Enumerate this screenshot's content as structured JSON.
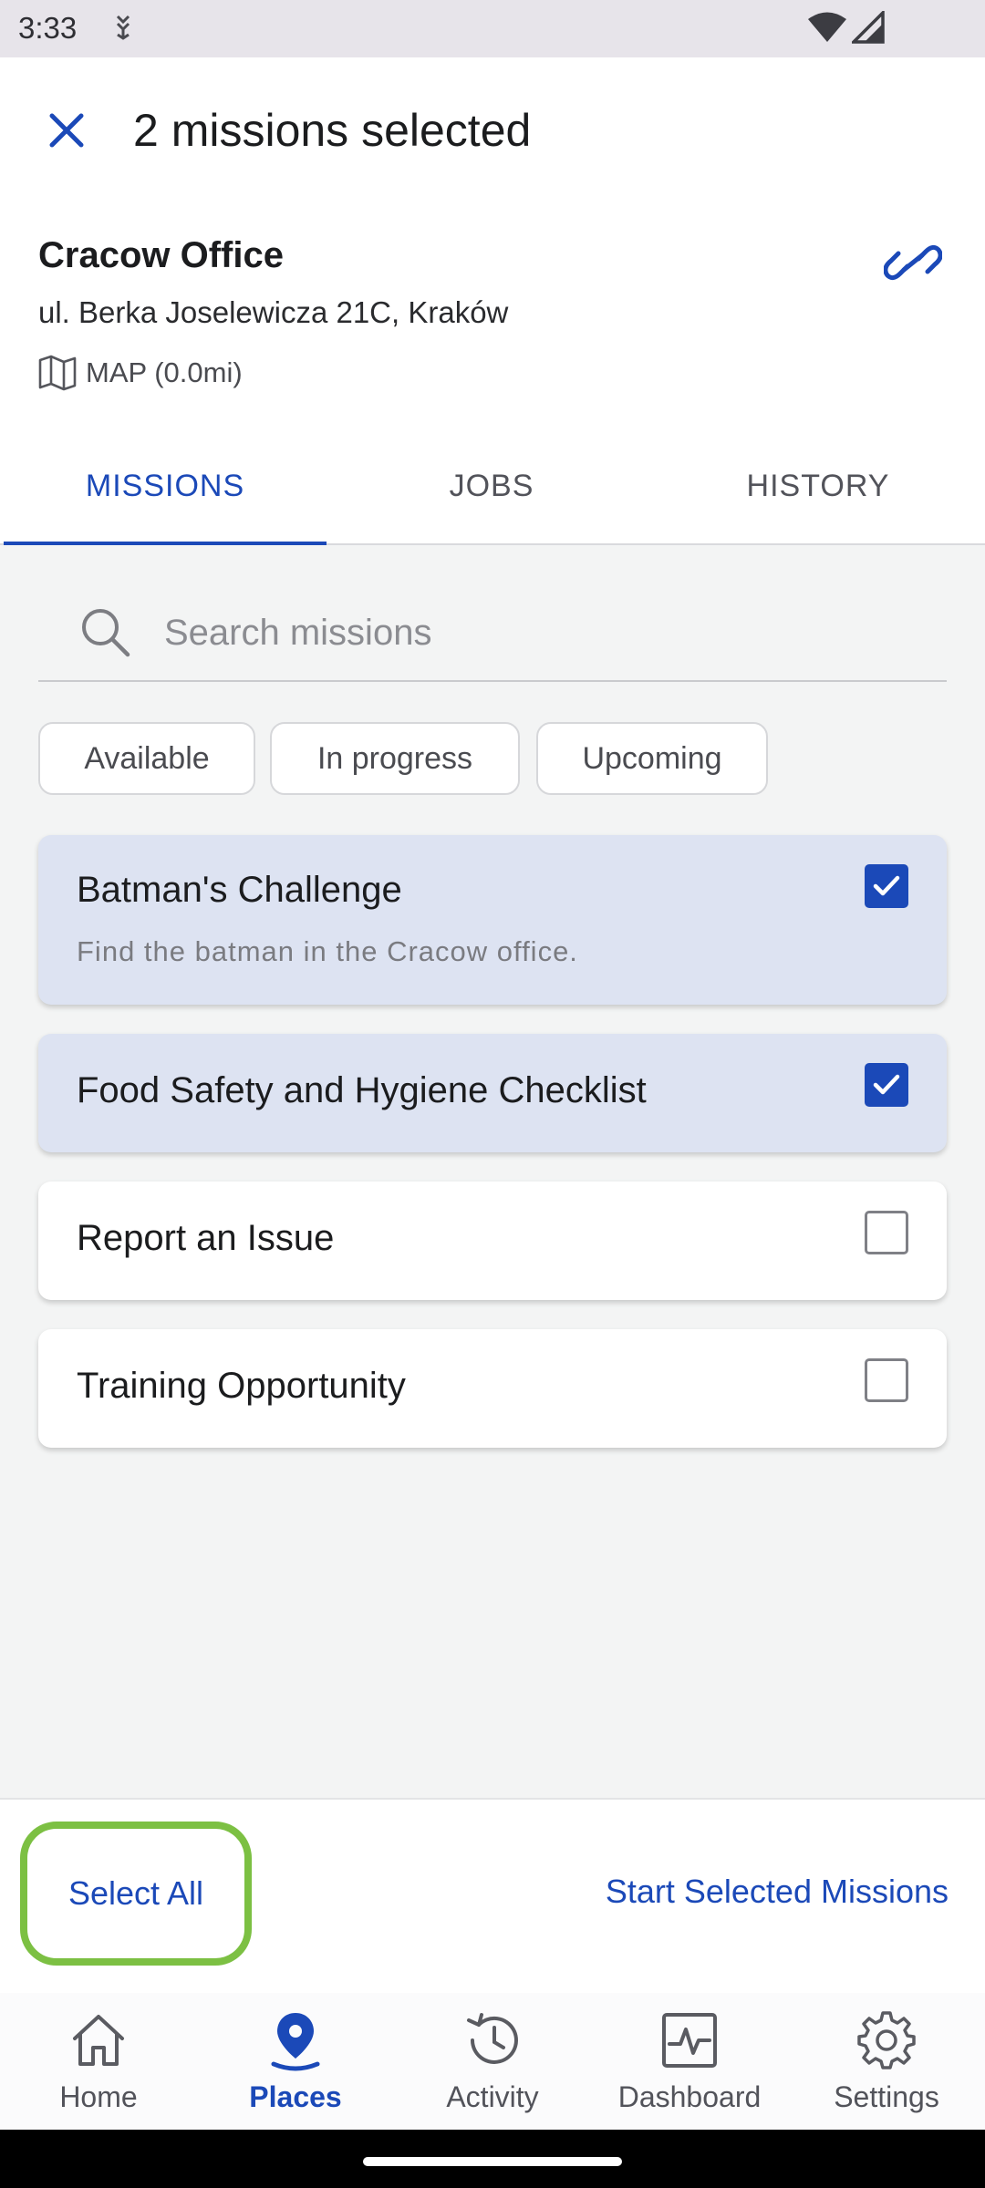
{
  "status_bar": {
    "time": "3:33"
  },
  "header": {
    "title": "2 missions selected",
    "close_icon": "close-icon",
    "place": {
      "name": "Cracow Office",
      "address": "ul. Berka Joselewicza 21C, Kraków",
      "map_label": "MAP (0.0mi)",
      "link_icon": "link-icon"
    }
  },
  "tabs": [
    {
      "label": "MISSIONS",
      "active": true
    },
    {
      "label": "JOBS",
      "active": false
    },
    {
      "label": "HISTORY",
      "active": false
    }
  ],
  "search": {
    "placeholder": "Search missions",
    "value": ""
  },
  "filters": [
    {
      "label": "Available"
    },
    {
      "label": "In progress"
    },
    {
      "label": "Upcoming"
    }
  ],
  "missions": [
    {
      "title": "Batman's Challenge",
      "description": "Find the batman in the Cracow office.",
      "selected": true
    },
    {
      "title": "Food Safety and Hygiene Checklist",
      "selected": true
    },
    {
      "title": "Report an Issue",
      "selected": false
    },
    {
      "title": "Training Opportunity",
      "selected": false
    }
  ],
  "actions": {
    "select_all": "Select All",
    "start_selected": "Start Selected Missions"
  },
  "bottom_nav": [
    {
      "label": "Home",
      "icon": "home-icon",
      "active": false
    },
    {
      "label": "Places",
      "icon": "location-pin-icon",
      "active": true
    },
    {
      "label": "Activity",
      "icon": "history-icon",
      "active": false
    },
    {
      "label": "Dashboard",
      "icon": "dashboard-icon",
      "active": false
    },
    {
      "label": "Settings",
      "icon": "gear-icon",
      "active": false
    }
  ],
  "colors": {
    "accent": "#1b49b8",
    "selected_card": "#dde3f2",
    "highlight_ring": "#7cc043",
    "background": "#f3f4f4"
  }
}
